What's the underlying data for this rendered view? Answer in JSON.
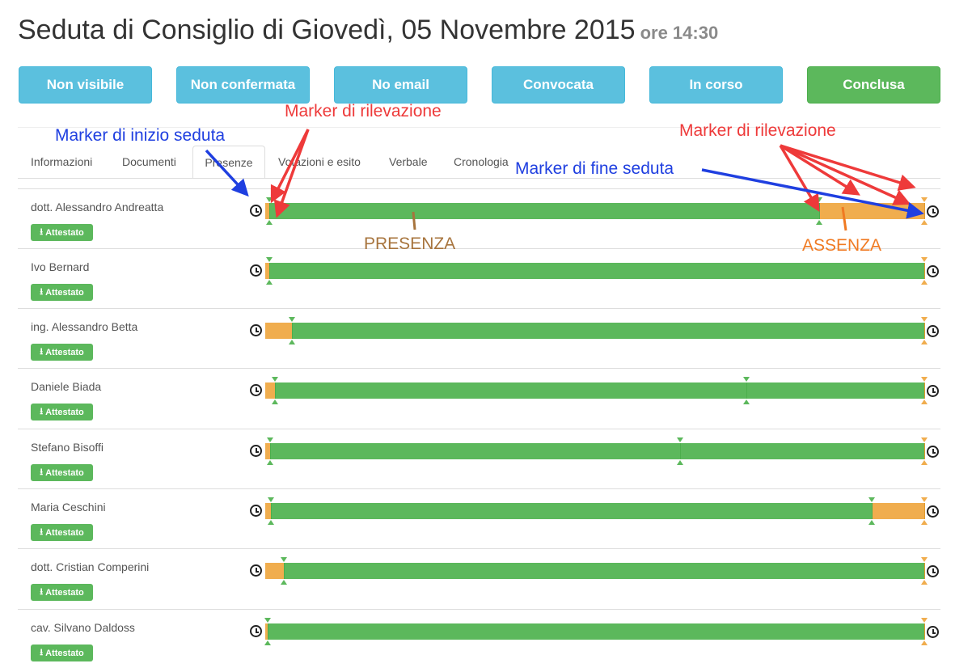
{
  "page": {
    "title": "Seduta di Consiglio di Giovedì, 05 Novembre 2015",
    "time": "ore 14:30"
  },
  "status_buttons": [
    {
      "label": "Non visibile",
      "style": "info"
    },
    {
      "label": "Non confermata",
      "style": "info"
    },
    {
      "label": "No email",
      "style": "info"
    },
    {
      "label": "Convocata",
      "style": "info"
    },
    {
      "label": "In corso",
      "style": "info"
    },
    {
      "label": "Conclusa",
      "style": "success"
    }
  ],
  "tabs": [
    {
      "label": "Informazioni",
      "active": false
    },
    {
      "label": "Documenti",
      "active": false
    },
    {
      "label": "Presenze",
      "active": true
    },
    {
      "label": "Votazioni e esito",
      "active": false
    },
    {
      "label": "Verbale",
      "active": false
    },
    {
      "label": "Cronologia",
      "active": false
    }
  ],
  "attest_label": "Attestato",
  "colors": {
    "presence": "#5cb85c",
    "absence": "#f0ad4e",
    "info": "#5bc0de"
  },
  "attendance": [
    {
      "name": "dott. Alessandro Andreatta",
      "segments": [
        [
          "a",
          0,
          0.006
        ],
        [
          "p",
          0.006,
          0.84
        ],
        [
          "a",
          0.84,
          1
        ]
      ],
      "markers": [
        0.006,
        0.84
      ]
    },
    {
      "name": "Ivo Bernard",
      "segments": [
        [
          "a",
          0,
          0.006
        ],
        [
          "p",
          0.006,
          1
        ]
      ],
      "markers": [
        0.006
      ]
    },
    {
      "name": "ing. Alessandro Betta",
      "segments": [
        [
          "a",
          0,
          0.041
        ],
        [
          "p",
          0.041,
          1
        ]
      ],
      "markers": [
        0.041
      ]
    },
    {
      "name": "Daniele Biada",
      "segments": [
        [
          "a",
          0,
          0.015
        ],
        [
          "p",
          0.015,
          1
        ]
      ],
      "markers": [
        0.015,
        0.73
      ]
    },
    {
      "name": "Stefano Bisoffi",
      "segments": [
        [
          "a",
          0,
          0.007
        ],
        [
          "p",
          0.007,
          1
        ]
      ],
      "markers": [
        0.007,
        0.63
      ]
    },
    {
      "name": "Maria Ceschini",
      "segments": [
        [
          "a",
          0,
          0.008
        ],
        [
          "p",
          0.008,
          0.92
        ],
        [
          "a",
          0.92,
          1
        ]
      ],
      "markers": [
        0.008,
        0.92
      ]
    },
    {
      "name": "dott. Cristian Comperini",
      "segments": [
        [
          "a",
          0,
          0.028
        ],
        [
          "p",
          0.028,
          1
        ]
      ],
      "markers": [
        0.028
      ]
    },
    {
      "name": "cav. Silvano Daldoss",
      "segments": [
        [
          "a",
          0,
          0.004
        ],
        [
          "p",
          0.004,
          1
        ]
      ],
      "markers": [
        0.004
      ]
    }
  ],
  "annotations": {
    "start_marker": "Marker di inizio seduta",
    "detection_marker_1": "Marker di rilevazione",
    "detection_marker_2": "Marker di rilevazione",
    "end_marker": "Marker di fine seduta",
    "presence": "PRESENZA",
    "absence": "ASSENZA"
  }
}
